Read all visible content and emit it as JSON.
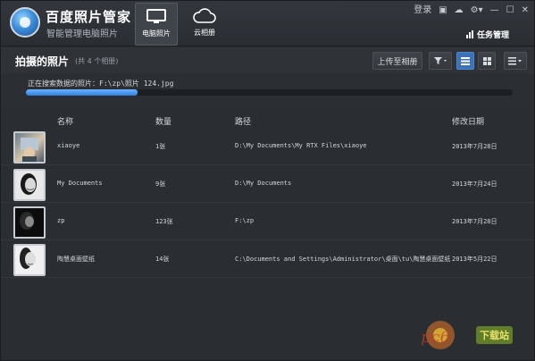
{
  "app": {
    "title": "百度照片管家",
    "subtitle": "智能管理电脑照片"
  },
  "nav": {
    "tabs": [
      {
        "label": "电脑照片",
        "icon": "monitor-icon",
        "active": true
      },
      {
        "label": "云相册",
        "icon": "cloud-icon",
        "active": false
      }
    ]
  },
  "top_right": {
    "login": "登录",
    "task_manager": "任务管理",
    "icons": [
      "message-icon",
      "cloud-sync-icon",
      "settings-icon",
      "minimize-icon",
      "maximize-icon",
      "close-icon"
    ]
  },
  "toolbar": {
    "title": "拍摄的照片",
    "count": "(共 4 个相册)",
    "upload_label": "上传至相册"
  },
  "progress": {
    "text": "正在搜索数据的照片：F:\\zp\\照片 124.jpg",
    "fraction": 0.23,
    "color": "#2d7fe0"
  },
  "table": {
    "headers": {
      "name": "名称",
      "count": "数量",
      "path": "路径",
      "date": "修改日期"
    },
    "rows": [
      {
        "name": "xiaoye",
        "count": "1张",
        "path": "D:\\My Documents\\My RTX Files\\xiaoye",
        "date": "2013年7月28日"
      },
      {
        "name": "My Documents",
        "count": "9张",
        "path": "D:\\My Documents",
        "date": "2013年7月24日"
      },
      {
        "name": "zp",
        "count": "123张",
        "path": "F:\\zp",
        "date": "2013年7月28日"
      },
      {
        "name": "陶慧桌面壁纸",
        "count": "14张",
        "path": "C:\\Documents  and Settings\\Administrator\\桌面\\tu\\陶慧桌面壁纸",
        "date": "2013年5月22日"
      }
    ]
  },
  "watermark": {
    "text": "下载站"
  }
}
